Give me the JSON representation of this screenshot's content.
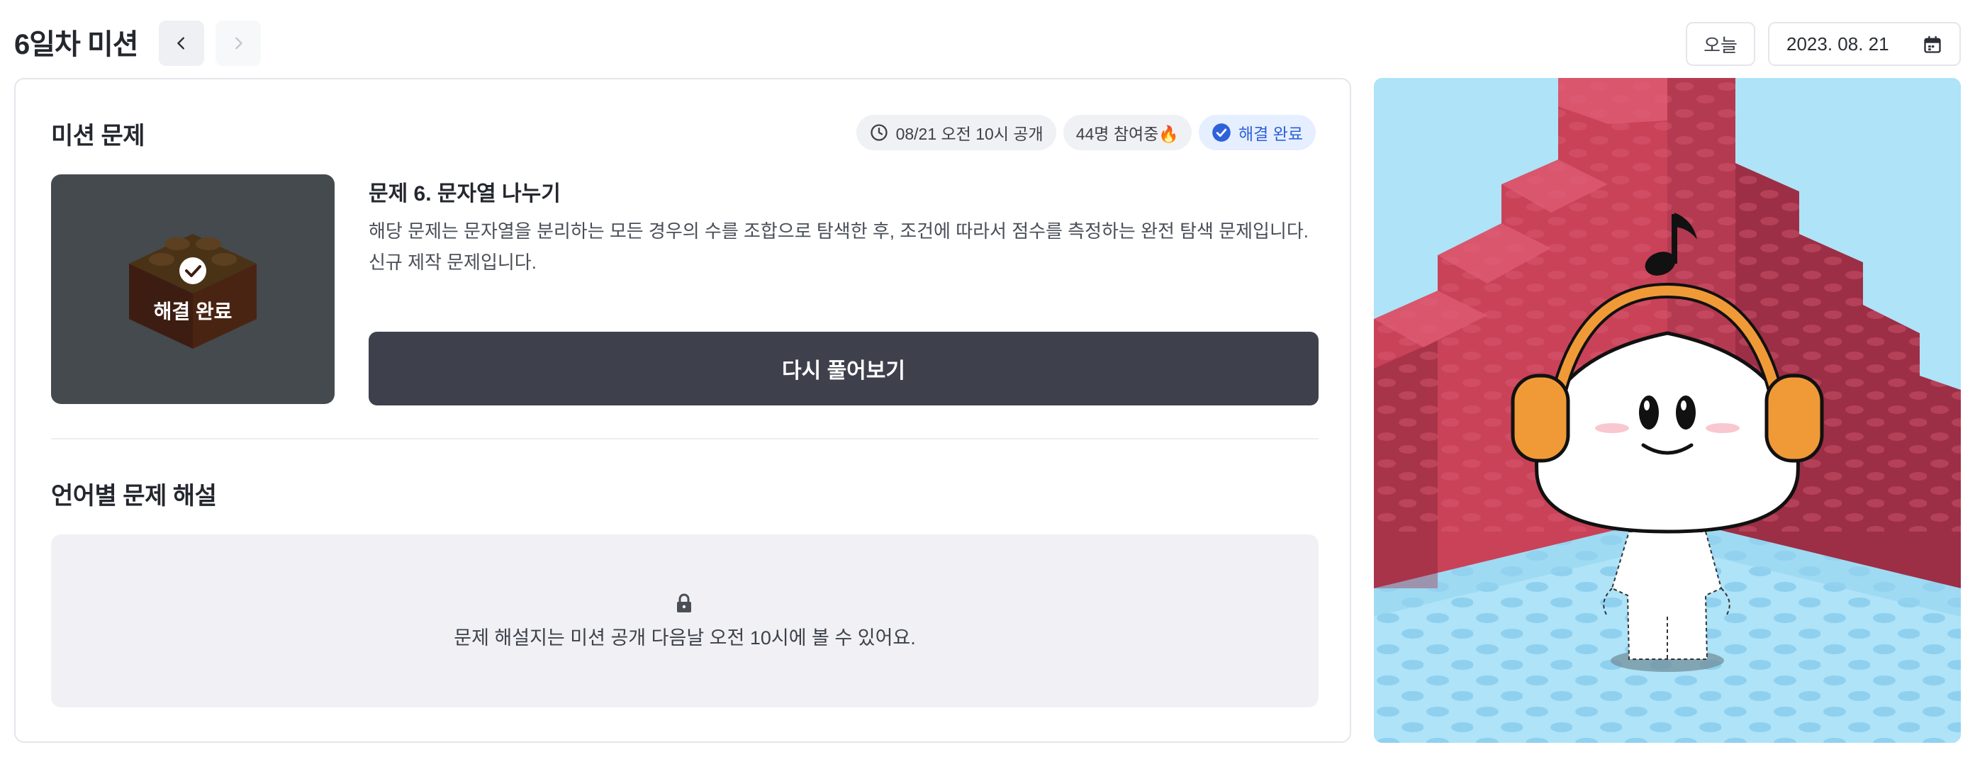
{
  "header": {
    "title": "6일차 미션",
    "prev_icon": "chevron-left-icon",
    "next_icon": "chevron-right-icon",
    "today_label": "오늘",
    "date_value": "2023. 08. 21",
    "calendar_icon": "calendar-icon"
  },
  "mission": {
    "section_title": "미션 문제",
    "badges": {
      "open": "08/21 오전 10시 공개",
      "participants": "44명 참여중🔥",
      "status": "해결 완료"
    },
    "thumbnail_label": "해결 완료",
    "problem_title": "문제 6. 문자열 나누기",
    "problem_desc": "해당 문제는 문자열을 분리하는 모든 경우의 수를 조합으로 탐색한 후, 조건에 따라서 점수를 측정하는 완전 탐색 문제입니다. 신규 제작 문제입니다.",
    "retry_label": "다시 풀어보기"
  },
  "solution": {
    "section_title": "언어별 문제 해설",
    "locked_message": "문제 해설지는 미션 공개 다음날 오전 10시에 볼 수 있어요."
  },
  "colors": {
    "accent_blue": "#2e62d9",
    "button_dark": "#3e414c",
    "brick_red": "#d1475f",
    "sky": "#aee3f8"
  }
}
